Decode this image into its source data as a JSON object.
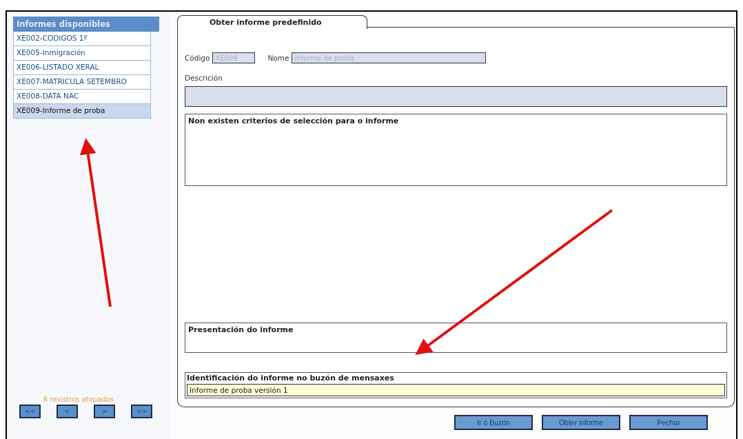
{
  "reports_panel": {
    "title": "Informes disponibles",
    "items": [
      {
        "label": "XE002-CODIGOS 1º",
        "selected": false
      },
      {
        "label": "XE005-Inmigración",
        "selected": false
      },
      {
        "label": "XE006-LISTADO XERAL",
        "selected": false
      },
      {
        "label": "XE007-MATRICULA SETEMBRO",
        "selected": false
      },
      {
        "label": "XE008-DATA NAC",
        "selected": false
      },
      {
        "label": "XE009-Informe de proba",
        "selected": true
      }
    ],
    "count": "6 rexistros atopados",
    "pager": [
      "<<",
      "<",
      ">",
      ">>"
    ]
  },
  "tab": {
    "label": "Obter informe predefinido"
  },
  "form": {
    "code_label": "Código",
    "code_value": "XE009",
    "name_label": "Nome",
    "name_value": "Informe de proba",
    "description_label": "Descrición",
    "criteria_title": "Non existen criterios de selección para o informe",
    "presentation_title": "Presentación do informe",
    "identification_title": "Identificación do informe no buzón de mensaxes",
    "identification_value": "Informe de proba versión 1"
  },
  "buttons": [
    "Ir ó Buzón",
    "Obter informe",
    "Pechar"
  ]
}
